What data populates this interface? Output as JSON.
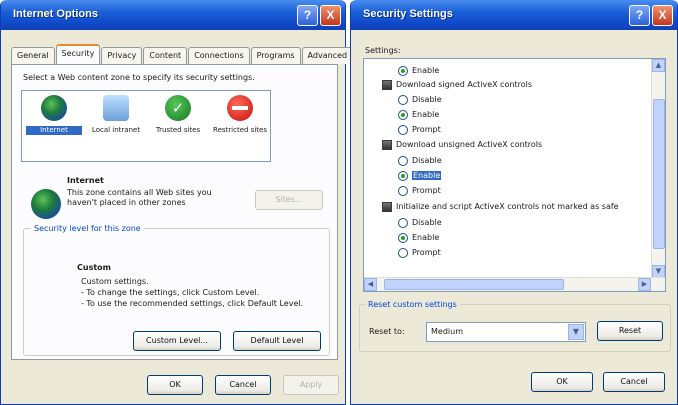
{
  "internet_options": {
    "title": "Internet Options",
    "help_glyph": "?",
    "close_glyph": "X",
    "tabs": [
      "General",
      "Security",
      "Privacy",
      "Content",
      "Connections",
      "Programs",
      "Advanced"
    ],
    "active_tab": "Security",
    "zone_prompt": "Select a Web content zone to specify its security settings.",
    "zones": [
      {
        "label": "Internet",
        "icon": "globe-icon"
      },
      {
        "label": "Local intranet",
        "icon": "local-intranet-icon"
      },
      {
        "label": "Trusted sites",
        "icon": "trusted-sites-icon"
      },
      {
        "label": "Restricted sites",
        "icon": "restricted-sites-icon"
      }
    ],
    "selected_zone": "Internet",
    "zone_title": "Internet",
    "zone_desc_1": "This zone contains all Web sites you",
    "zone_desc_2": "haven't placed in other zones",
    "sites_button": "Sites...",
    "security_level_label": "Security level for this zone",
    "level_title": "Custom",
    "level_line_1": "Custom settings.",
    "level_line_2": "- To change the settings, click Custom Level.",
    "level_line_3": "- To use the recommended settings, click Default Level.",
    "custom_level_button": "Custom Level...",
    "default_level_button": "Default Level",
    "ok_button": "OK",
    "cancel_button": "Cancel",
    "apply_button": "Apply"
  },
  "security_settings": {
    "title": "Security Settings",
    "help_glyph": "?",
    "close_glyph": "X",
    "settings_label": "Settings:",
    "items": {
      "enable_top": "Enable",
      "group1": "Download signed ActiveX controls",
      "g1_disable": "Disable",
      "g1_enable": "Enable",
      "g1_prompt": "Prompt",
      "group2": "Download unsigned ActiveX controls",
      "g2_disable": "Disable",
      "g2_enable": "Enable",
      "g2_prompt": "Prompt",
      "group3": "Initialize and script ActiveX controls not marked as safe",
      "g3_disable": "Disable",
      "g3_enable": "Enable",
      "g3_prompt": "Prompt"
    },
    "reset_group_label": "Reset custom settings",
    "reset_to_label": "Reset to:",
    "reset_to_value": "Medium",
    "reset_button": "Reset",
    "ok_button": "OK",
    "cancel_button": "Cancel"
  }
}
